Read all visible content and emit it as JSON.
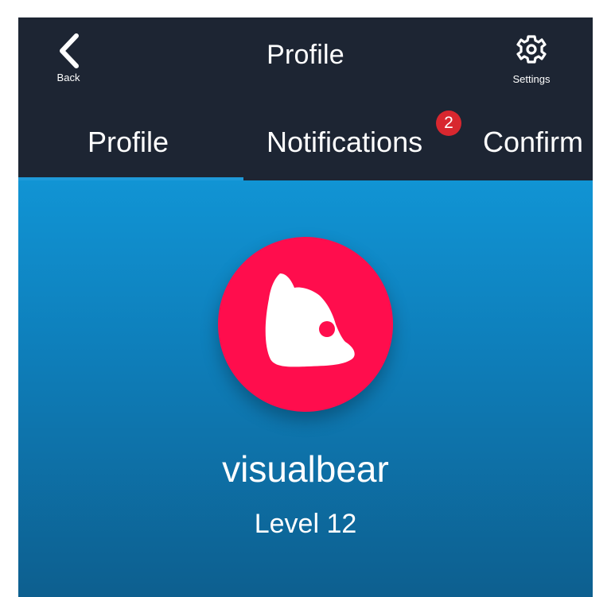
{
  "header": {
    "title": "Profile",
    "back_label": "Back",
    "settings_label": "Settings"
  },
  "tabs": [
    {
      "label": "Profile",
      "selected": true
    },
    {
      "label": "Notifications",
      "badge": "2"
    },
    {
      "label": "Confirm"
    }
  ],
  "profile": {
    "username": "visualbear",
    "level": "Level 12"
  },
  "icons": {
    "back": "chevron-left-icon",
    "settings": "gear-icon",
    "avatar": "bear-head-icon"
  },
  "colors": {
    "topbar": "#1d2533",
    "accent": "#1e9ad9",
    "avatar": "#ff0d4d",
    "badge": "#d8272f"
  }
}
